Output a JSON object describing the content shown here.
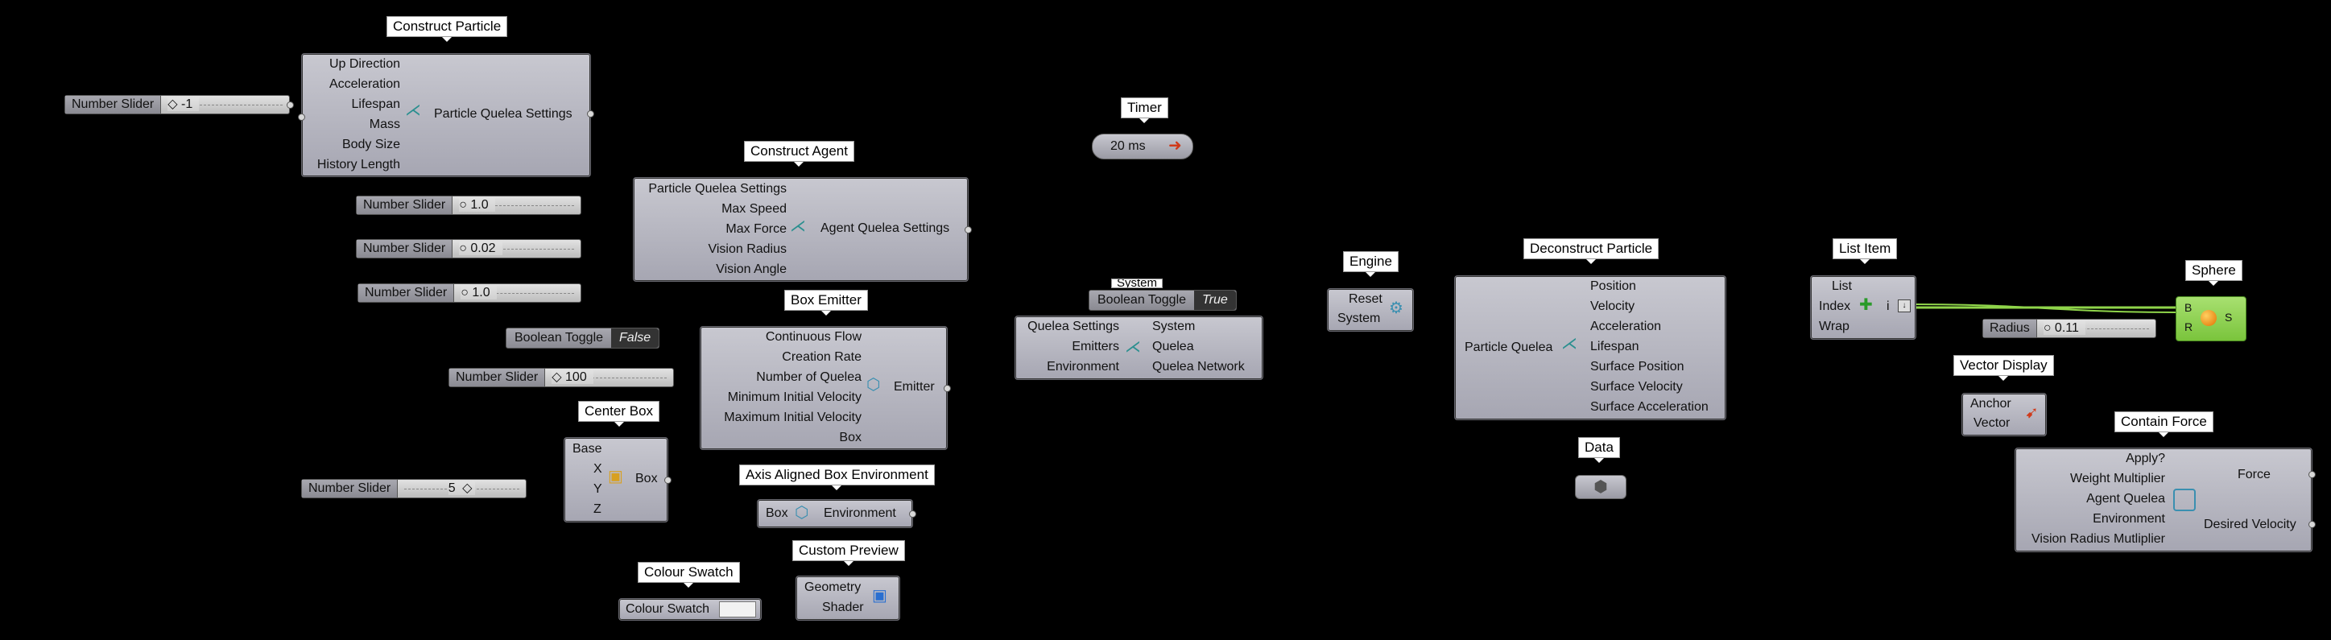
{
  "sliders": [
    {
      "label": "Number Slider",
      "value": "-1"
    },
    {
      "label": "Number Slider",
      "value": "1.0"
    },
    {
      "label": "Number Slider",
      "value": "0.02"
    },
    {
      "label": "Number Slider",
      "value": "1.0"
    },
    {
      "label": "Number Slider",
      "value": "100"
    },
    {
      "label": "Number Slider",
      "value": "5"
    },
    {
      "label": "Radius",
      "value": "0.11"
    }
  ],
  "toggles": [
    {
      "label": "Boolean Toggle",
      "value": "False"
    },
    {
      "label": "Boolean Toggle",
      "value": "True"
    }
  ],
  "construct_particle": {
    "title": "Construct Particle",
    "inputs": [
      "Up Direction",
      "Acceleration",
      "Lifespan",
      "Mass",
      "Body Size",
      "History Length"
    ],
    "output": "Particle Quelea Settings"
  },
  "construct_agent": {
    "title": "Construct Agent",
    "inputs": [
      "Particle Quelea Settings",
      "Max Speed",
      "Max Force",
      "Vision Radius",
      "Vision Angle"
    ],
    "output": "Agent Quelea Settings"
  },
  "box_emitter": {
    "title": "Box Emitter",
    "inputs": [
      "Continuous Flow",
      "Creation Rate",
      "Number of Quelea",
      "Minimum Initial Velocity",
      "Maximum Initial Velocity",
      "Box"
    ],
    "output": "Emitter"
  },
  "center_box": {
    "title": "Center Box",
    "inputs": [
      "Base",
      "X",
      "Y",
      "Z"
    ],
    "output": "Box"
  },
  "axis_box_env": {
    "title": "Axis Aligned Box Environment",
    "input": "Box",
    "output": "Environment"
  },
  "custom_preview": {
    "title": "Custom Preview",
    "inputs": [
      "Geometry",
      "Shader"
    ]
  },
  "colour_swatch": {
    "title": "Colour Swatch",
    "label": "Colour Swatch"
  },
  "timer": {
    "title": "Timer",
    "value": "20 ms"
  },
  "system": {
    "title": "System",
    "inputs": [
      "Quelea Settings",
      "Emitters",
      "Environment"
    ],
    "outputs": [
      "System",
      "Quelea",
      "Quelea Network"
    ]
  },
  "engine": {
    "title": "Engine",
    "inputs": [
      "Reset",
      "System"
    ]
  },
  "deconstruct_particle": {
    "title": "Deconstruct Particle",
    "input": "Particle Quelea",
    "outputs": [
      "Position",
      "Velocity",
      "Acceleration",
      "Lifespan",
      "Surface Position",
      "Surface Velocity",
      "Surface Acceleration"
    ]
  },
  "data": {
    "title": "Data"
  },
  "list_item": {
    "title": "List Item",
    "inputs": [
      "List",
      "Index",
      "Wrap"
    ],
    "output": "i"
  },
  "sphere": {
    "title": "Sphere",
    "inputs": [
      "B",
      "R"
    ],
    "output": "S"
  },
  "vector_display": {
    "title": "Vector Display",
    "inputs": [
      "Anchor",
      "Vector"
    ]
  },
  "contain_force": {
    "title": "Contain Force",
    "inputs": [
      "Apply?",
      "Weight Multiplier",
      "Agent Quelea",
      "Environment",
      "Vision Radius Mutliplier"
    ],
    "outputs": [
      "Force",
      "Desired Velocity"
    ]
  },
  "colors": {
    "canvas": "#000000",
    "component": "#b4b4be",
    "sphere_selected": "#8fd44a",
    "wire_selected": "#8fd44a"
  }
}
